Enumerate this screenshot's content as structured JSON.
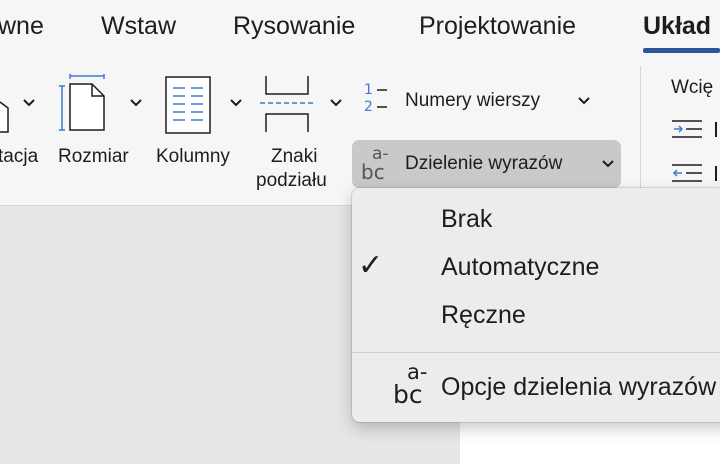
{
  "tabs": [
    {
      "label": "wne",
      "active": false
    },
    {
      "label": "Wstaw",
      "active": false
    },
    {
      "label": "Rysowanie",
      "active": false
    },
    {
      "label": "Projektowanie",
      "active": false
    },
    {
      "label": "Układ",
      "active": true
    }
  ],
  "ribbon": {
    "orientation_label": "tacja",
    "size_label": "Rozmiar",
    "columns_label": "Kolumny",
    "breaks_label_line1": "Znaki",
    "breaks_label_line2": "podziału",
    "line_numbers_label": "Numery wierszy",
    "line_numbers_icon_top": "1",
    "line_numbers_icon_bottom": "2",
    "hyphenation_label": "Dzielenie wyrazów",
    "hyph_icon_top": "a-",
    "hyph_icon_bottom": "bc",
    "indent_label": "Wcię"
  },
  "hyphenation_menu": {
    "items": [
      {
        "label": "Brak",
        "checked": false
      },
      {
        "label": "Automatyczne",
        "checked": true
      },
      {
        "label": "Ręczne",
        "checked": false
      }
    ],
    "options_label": "Opcje dzielenia wyrazów",
    "options_icon_top": "a-",
    "options_icon_bottom": "bc",
    "checkmark": "✓"
  },
  "colors": {
    "accent": "#2b579a",
    "ribbon_bg": "#f6f6f6",
    "menu_bg": "#ececec",
    "icon_blue": "#3d7bd1"
  }
}
